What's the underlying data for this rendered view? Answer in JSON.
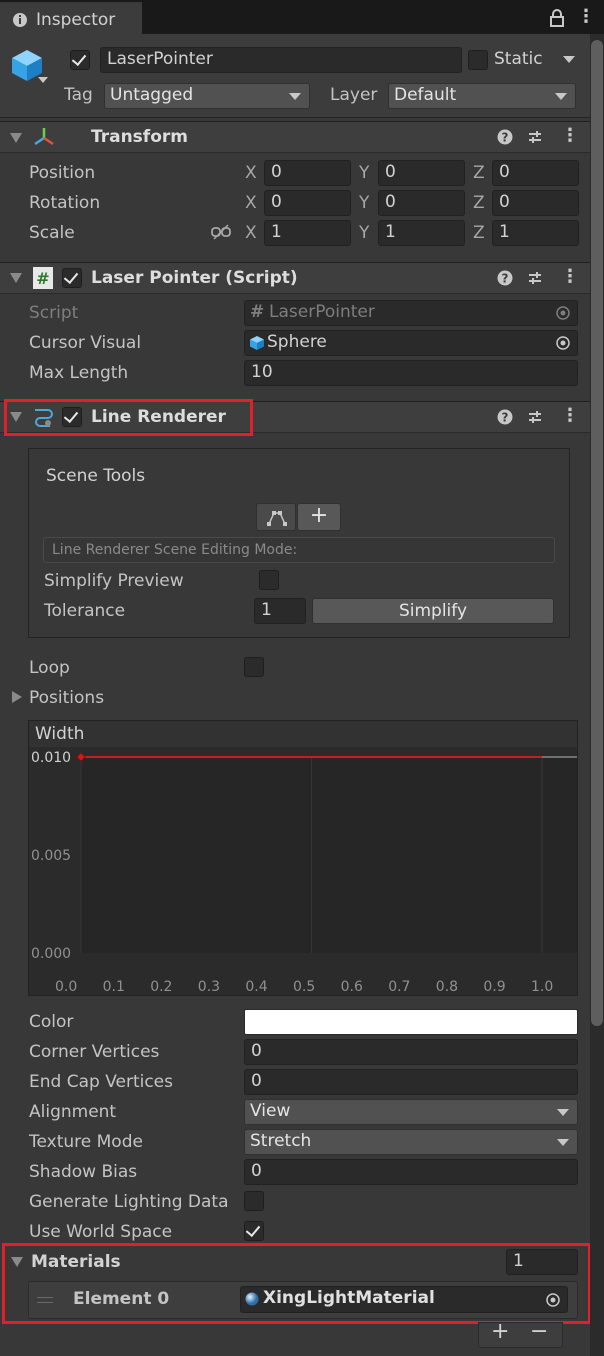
{
  "window": {
    "tab_title": "Inspector"
  },
  "gameobject": {
    "name": "LaserPointer",
    "static_label": "Static",
    "tag_label": "Tag",
    "tag_value": "Untagged",
    "layer_label": "Layer",
    "layer_value": "Default"
  },
  "transform": {
    "title": "Transform",
    "rows": [
      {
        "label": "Position",
        "x": "0",
        "y": "0",
        "z": "0"
      },
      {
        "label": "Rotation",
        "x": "0",
        "y": "0",
        "z": "0"
      },
      {
        "label": "Scale",
        "x": "1",
        "y": "1",
        "z": "1"
      }
    ],
    "axis": {
      "x": "X",
      "y": "Y",
      "z": "Z"
    }
  },
  "script_comp": {
    "title": "Laser Pointer (Script)",
    "script_label": "Script",
    "script_value": "LaserPointer",
    "cursor_label": "Cursor Visual",
    "cursor_value": "Sphere",
    "maxlen_label": "Max Length",
    "maxlen_value": "10"
  },
  "line_renderer": {
    "title": "Line Renderer",
    "scene_tools": "Scene Tools",
    "add_glyph": "+",
    "mode_placeholder": "Line Renderer Scene Editing Mode:",
    "simplify_preview_label": "Simplify Preview",
    "tolerance_label": "Tolerance",
    "tolerance_value": "1",
    "simplify_button": "Simplify",
    "loop_label": "Loop",
    "positions_label": "Positions",
    "width_label": "Width",
    "color_label": "Color",
    "color_value": "#ffffff",
    "corner_label": "Corner Vertices",
    "corner_value": "0",
    "endcap_label": "End Cap Vertices",
    "endcap_value": "0",
    "alignment_label": "Alignment",
    "alignment_value": "View",
    "texture_label": "Texture Mode",
    "texture_value": "Stretch",
    "shadow_label": "Shadow Bias",
    "shadow_value": "0",
    "lighting_label": "Generate Lighting Data",
    "worldspace_label": "Use World Space",
    "use_world_space": true
  },
  "chart_data": {
    "type": "line",
    "title": "Width",
    "x": [
      0.0,
      1.0
    ],
    "y": [
      0.01,
      0.01
    ],
    "xticks": [
      "0.0",
      "0.1",
      "0.2",
      "0.3",
      "0.4",
      "0.5",
      "0.6",
      "0.7",
      "0.8",
      "0.9",
      "1.0"
    ],
    "yticks": [
      "0.010",
      "0.005",
      "0.000"
    ],
    "xlim": [
      0.0,
      1.0
    ],
    "ylim": [
      0.0,
      0.01
    ],
    "line_color": "#c81e1e"
  },
  "materials": {
    "title": "Materials",
    "count": "1",
    "element_label": "Element 0",
    "element_value": "XingLightMaterial",
    "add_glyph": "+",
    "remove_glyph": "−"
  },
  "colors": {
    "highlight": "#e0202a",
    "accent_blue": "#4aa8e0"
  }
}
